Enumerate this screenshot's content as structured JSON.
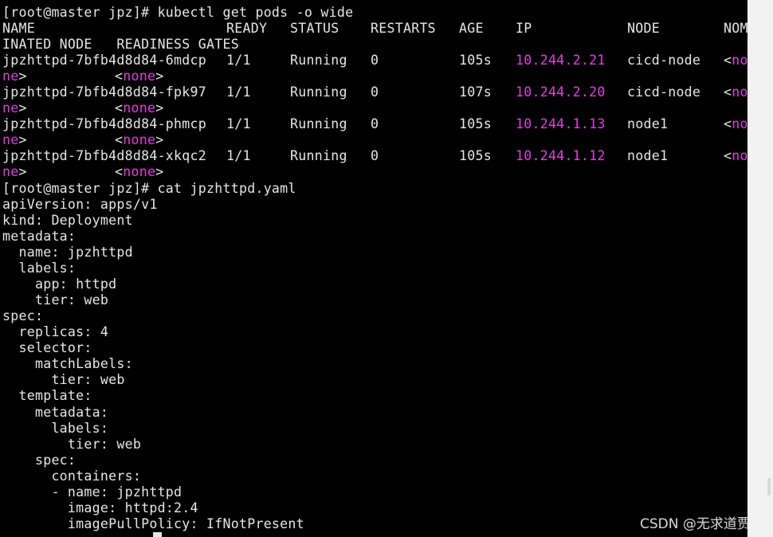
{
  "colors": {
    "background": "#000000",
    "text": "#e6e6e6",
    "accent": "#e040e0"
  },
  "terminal": {
    "prompt_cmd1": "[root@master jpz]# kubectl get pods -o wide",
    "headers": [
      "NAME",
      "READY",
      "STATUS",
      "RESTARTS",
      "AGE",
      "IP",
      "NODE",
      "NOM"
    ],
    "header_wrap": "INATED NODE   READINESS GATES",
    "pods": [
      {
        "name": "jpzhttpd-7bfb4d8d84-6mdcp",
        "ready": "1/1",
        "status": "Running",
        "restarts": "0",
        "age": "105s",
        "ip": "10.244.2.21",
        "node": "cicd-node",
        "nom_head": "<no",
        "nom_tail": "ne>",
        "gates": "<none>"
      },
      {
        "name": "jpzhttpd-7bfb4d8d84-fpk97",
        "ready": "1/1",
        "status": "Running",
        "restarts": "0",
        "age": "107s",
        "ip": "10.244.2.20",
        "node": "cicd-node",
        "nom_head": "<no",
        "nom_tail": "ne>",
        "gates": "<none>"
      },
      {
        "name": "jpzhttpd-7bfb4d8d84-phmcp",
        "ready": "1/1",
        "status": "Running",
        "restarts": "0",
        "age": "105s",
        "ip": "10.244.1.13",
        "node": "node1",
        "nom_head": "<no",
        "nom_tail": "ne>",
        "gates": "<none>"
      },
      {
        "name": "jpzhttpd-7bfb4d8d84-xkqc2",
        "ready": "1/1",
        "status": "Running",
        "restarts": "0",
        "age": "105s",
        "ip": "10.244.1.12",
        "node": "node1",
        "nom_head": "<no",
        "nom_tail": "ne>",
        "gates": "<none>"
      }
    ],
    "prompt_cmd2": "[root@master jpz]# cat jpzhttpd.yaml",
    "yaml_lines": [
      "apiVersion: apps/v1",
      "kind: Deployment",
      "metadata:",
      "  name: jpzhttpd",
      "  labels:",
      "    app: httpd",
      "    tier: web",
      "spec:",
      "  replicas: 4",
      "  selector:",
      "    matchLabels:",
      "      tier: web",
      "  template:",
      "    metadata:",
      "      labels:",
      "        tier: web",
      "    spec:",
      "      containers:",
      "      - name: jpzhttpd",
      "        image: httpd:2.4",
      "        imagePullPolicy: IfNotPresent"
    ]
  },
  "watermark": "CSDN @无求道贾"
}
